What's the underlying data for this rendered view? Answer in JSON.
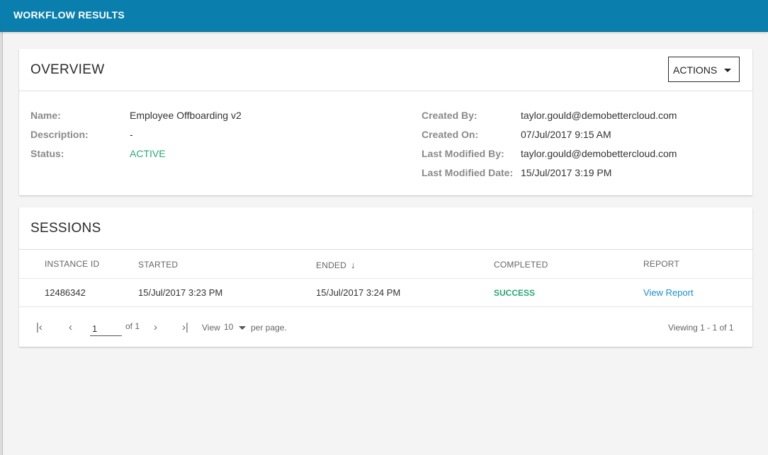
{
  "topbar": {
    "title": "WORKFLOW RESULTS"
  },
  "overview": {
    "title": "OVERVIEW",
    "actions_label": "ACTIONS",
    "name_label": "Name:",
    "name_value": "Employee Offboarding v2",
    "description_label": "Description:",
    "description_value": "-",
    "status_label": "Status:",
    "status_value": "ACTIVE",
    "created_by_label": "Created By:",
    "created_by_value": "taylor.gould@demobettercloud.com",
    "created_on_label": "Created On:",
    "created_on_value": "07/Jul/2017 9:15 AM",
    "last_modified_by_label": "Last Modified By:",
    "last_modified_by_value": "taylor.gould@demobettercloud.com",
    "last_modified_date_label": "Last Modified Date:",
    "last_modified_date_value": "15/Jul/2017 3:19 PM"
  },
  "sessions": {
    "title": "SESSIONS",
    "columns": [
      "INSTANCE ID",
      "STARTED",
      "ENDED",
      "COMPLETED",
      "REPORT"
    ],
    "rows": [
      {
        "instance_id": "12486342",
        "started": "15/Jul/2017 3:23 PM",
        "ended": "15/Jul/2017 3:24 PM",
        "completed": "SUCCESS",
        "report": "View Report"
      }
    ]
  },
  "pagination": {
    "page": "1",
    "of_label": "of 1",
    "view_label": "View",
    "per_page_value": "10",
    "per_page_label": "per page.",
    "viewing_label": "Viewing 1 - 1 of 1"
  },
  "colors": {
    "topbar": "#0a7fae",
    "success": "#2aa876",
    "link": "#1a8fd0"
  },
  "icons": {
    "first_page": "first-page-icon",
    "prev_page": "chevron-left-icon",
    "next_page": "chevron-right-icon",
    "last_page": "last-page-icon",
    "sort": "arrow-down-icon"
  }
}
